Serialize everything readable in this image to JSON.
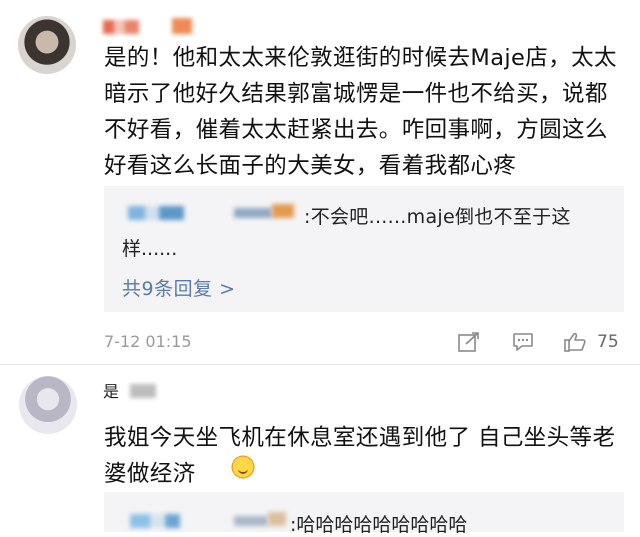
{
  "comment1": {
    "text": "是的！他和太太来伦敦逛街的时候去Maje店，太太暗示了他好久结果郭富城愣是一件也不给买，说都不好看，催着太太赶紧出去。咋回事啊，方圆这么好看这么长面子的大美女，看着我都心疼",
    "reply": {
      "text": ":不会吧......maje倒也不至于这",
      "text_cont": "样......",
      "more": "共9条回复 >"
    },
    "time": "7-12 01:15",
    "like_count": "75"
  },
  "comment2": {
    "name_prefix": "是",
    "text": "我姐今天坐飞机在休息室还遇到他了 自己坐头等老婆做经济",
    "reply": {
      "text": ":哈哈哈哈哈哈哈哈哈"
    }
  },
  "icons": {
    "share": "share-icon",
    "comment": "comment-icon",
    "like": "thumbs-up-icon",
    "emoji": "sun-smile-emoji-icon"
  }
}
